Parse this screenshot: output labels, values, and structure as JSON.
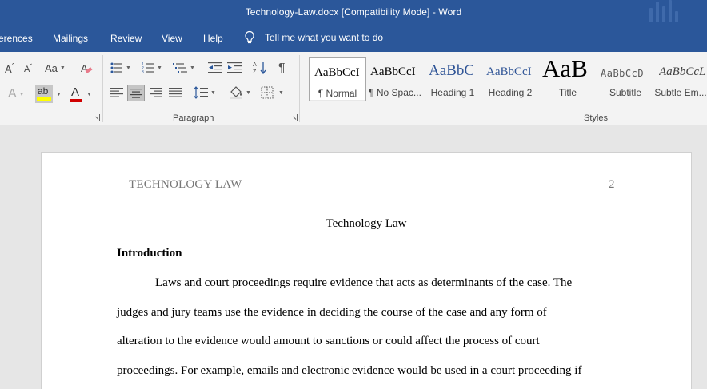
{
  "window": {
    "title": "Technology-Law.docx [Compatibility Mode]  -  Word"
  },
  "tabs": [
    {
      "label": "erences"
    },
    {
      "label": "Mailings"
    },
    {
      "label": "Review"
    },
    {
      "label": "View"
    },
    {
      "label": "Help"
    }
  ],
  "tell_me": {
    "label": "Tell me what you want to do",
    "icon": "lightbulb-icon"
  },
  "ribbon": {
    "font_group": {
      "grow_label": "A",
      "shrink_label": "A",
      "case_label": "Aa",
      "clear_format_label": "A",
      "text_effects_label": "A",
      "highlight_label": "ab",
      "highlight_color": "#ffff00",
      "font_color_label": "A",
      "font_color": "#d00000"
    },
    "paragraph_group": {
      "label": "Paragraph",
      "show_marks_label": "¶"
    },
    "styles_group": {
      "label": "Styles",
      "items": [
        {
          "preview": "AaBbCcI",
          "name": "¶ Normal",
          "selected": true
        },
        {
          "preview": "AaBbCcI",
          "name": "¶ No Spac...",
          "selected": false
        },
        {
          "preview": "AaBbC",
          "name": "Heading 1",
          "selected": false
        },
        {
          "preview": "AaBbCcI",
          "name": "Heading 2",
          "selected": false
        },
        {
          "preview": "AaB",
          "name": "Title",
          "selected": false
        },
        {
          "preview": "AaBbCcD",
          "name": "Subtitle",
          "selected": false
        },
        {
          "preview": "AaBbCcL",
          "name": "Subtle Em...",
          "selected": false
        }
      ]
    }
  },
  "document": {
    "header_left": "TECHNOLOGY LAW",
    "page_number": "2",
    "title": "Technology Law",
    "heading": "Introduction",
    "lines": [
      "Laws and court proceedings require evidence that acts as determinants of the case. The",
      "judges and jury teams use the evidence in deciding the course of the case and any form of",
      "alteration to the evidence would amount to sanctions or could affect the process of court",
      "proceedings. For example, emails and electronic evidence would be used in a court proceeding if"
    ]
  }
}
